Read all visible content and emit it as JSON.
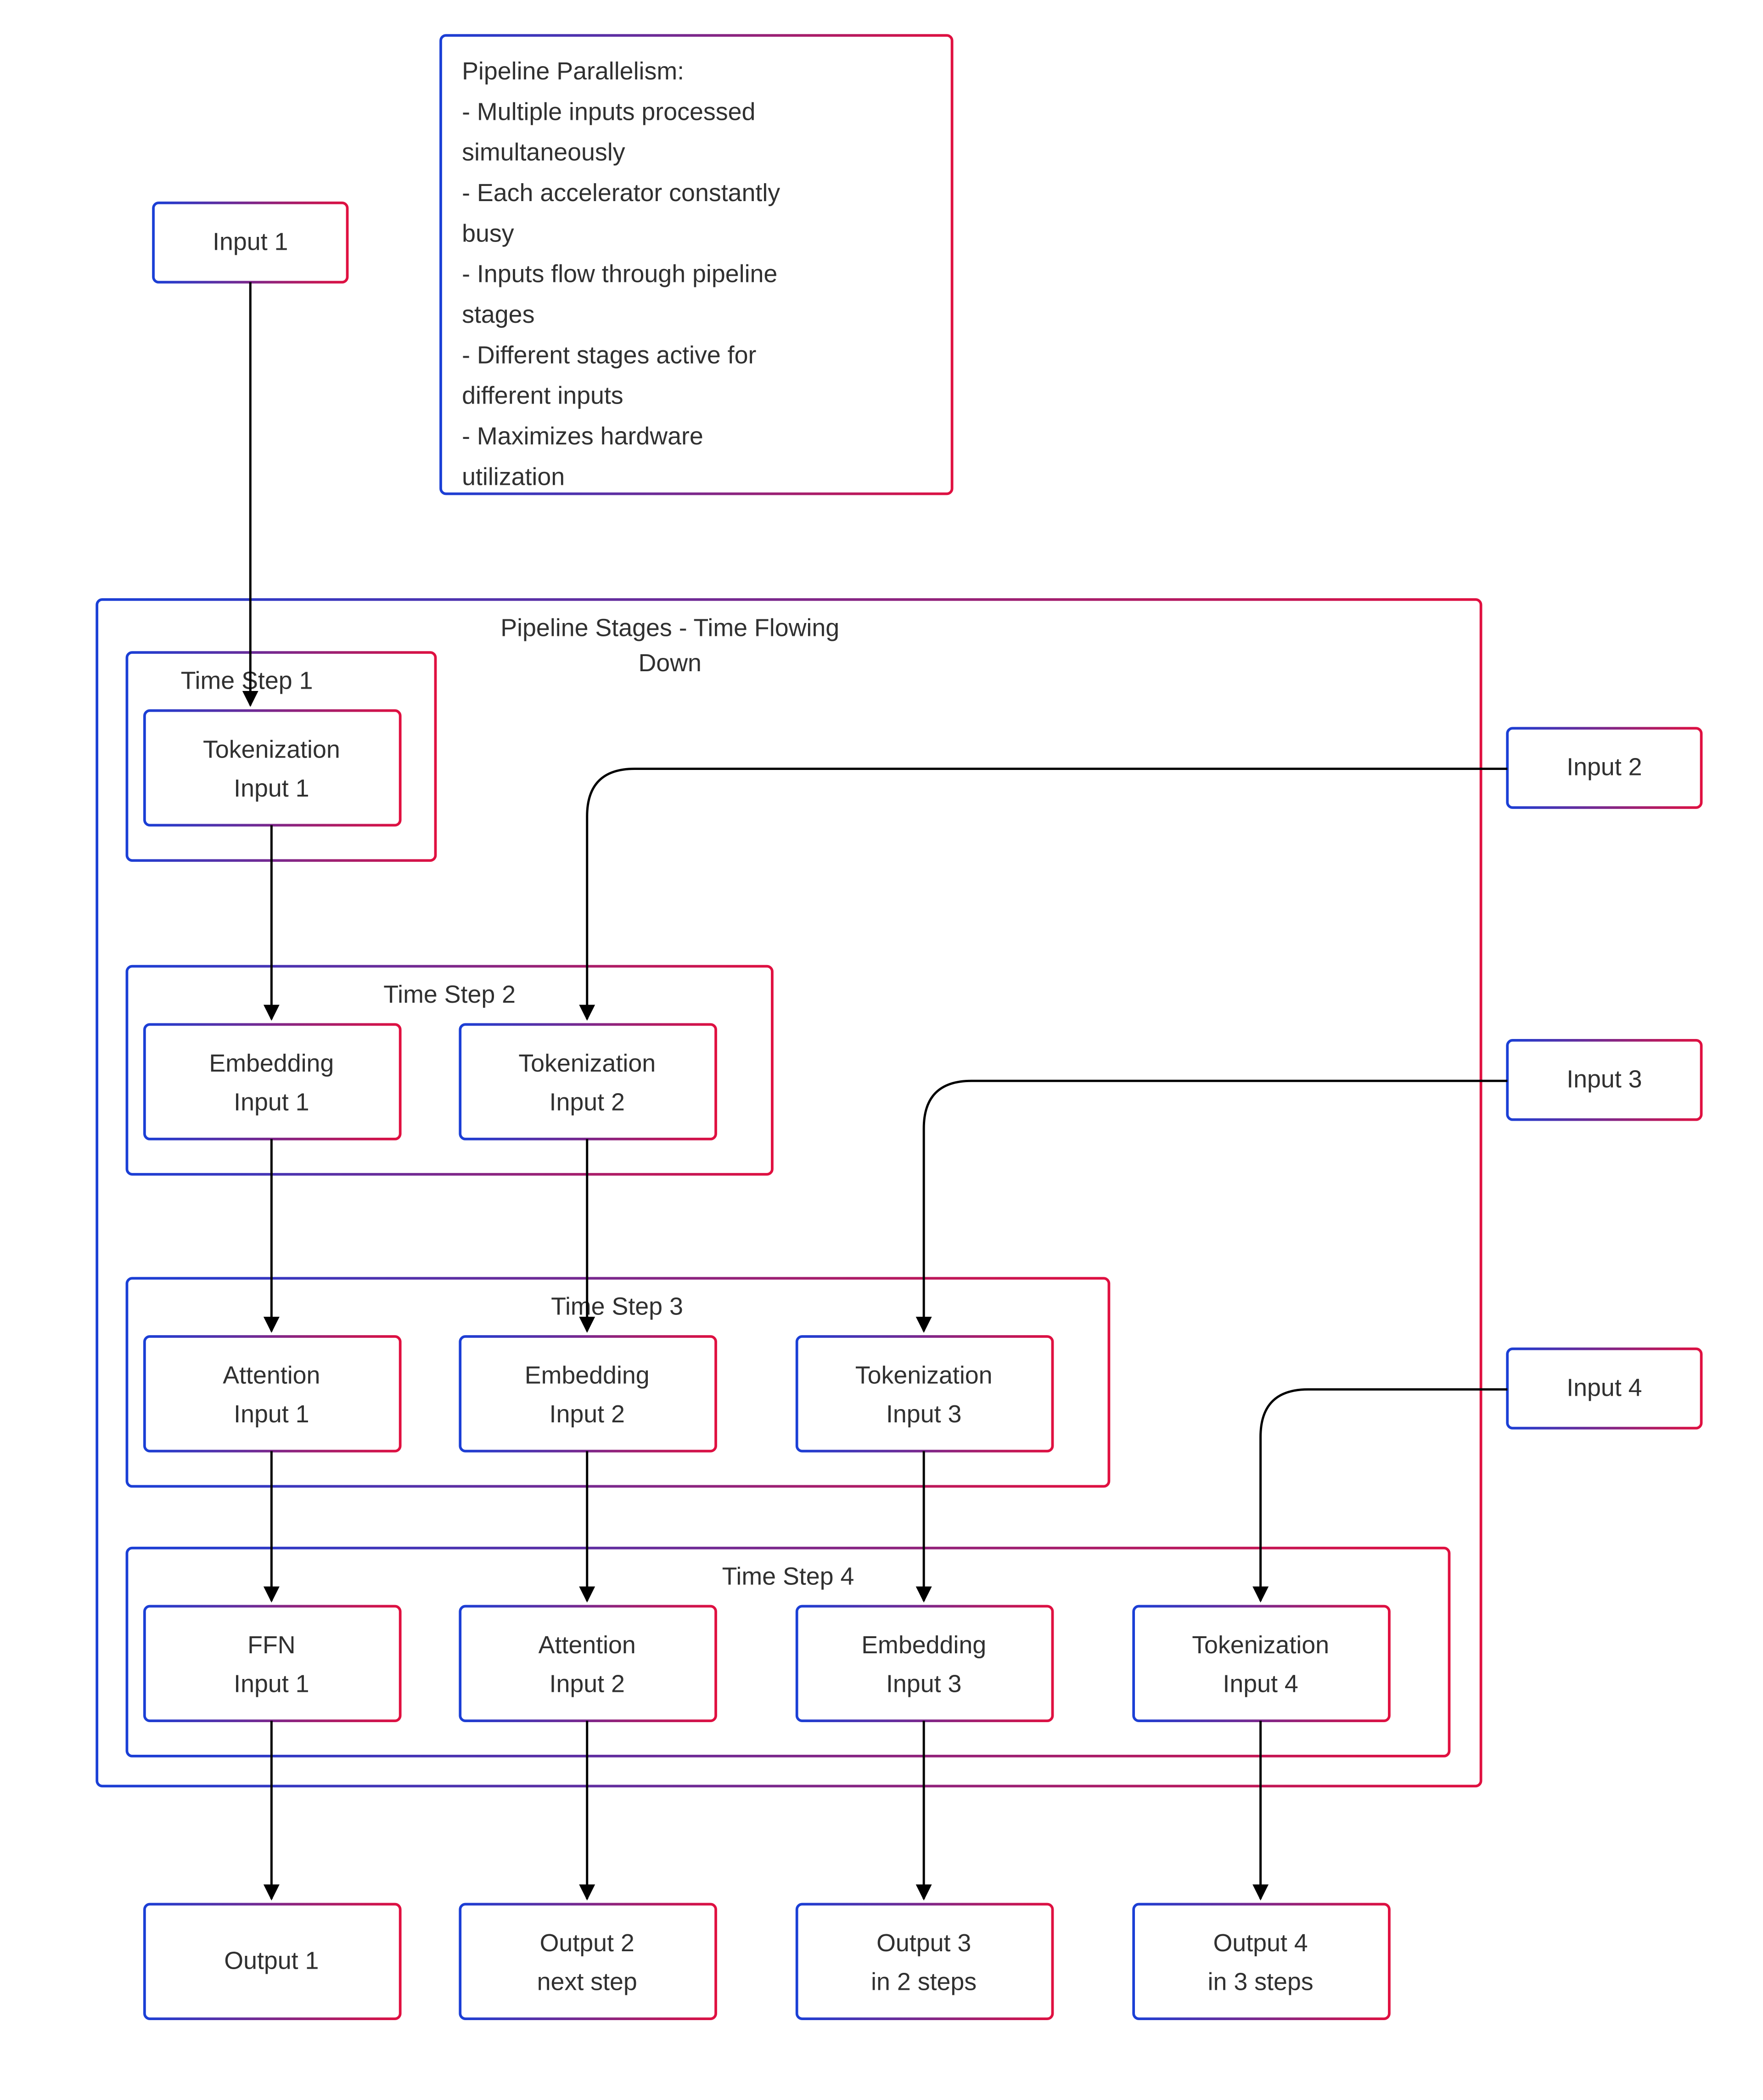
{
  "note": {
    "title": "Pipeline Parallelism:",
    "bullets": [
      "    - Multiple inputs processed",
      "simultaneously",
      "    - Each accelerator constantly",
      "busy",
      "    - Inputs flow through pipeline",
      "stages",
      "    - Different stages active for",
      "different inputs",
      "    - Maximizes hardware",
      "utilization"
    ]
  },
  "pipelineTitle1": "Pipeline Stages - Time Flowing",
  "pipelineTitle2": "Down",
  "inputs": {
    "i1": "Input 1",
    "i2": "Input 2",
    "i3": "Input 3",
    "i4": "Input 4"
  },
  "timesteps": {
    "t1": {
      "label": "Time Step 1",
      "cells": [
        "Tokenization",
        "Input 1"
      ]
    },
    "t2": {
      "label": "Time Step 2",
      "c1": [
        "Embedding",
        "Input 1"
      ],
      "c2": [
        "Tokenization",
        "Input 2"
      ]
    },
    "t3": {
      "label": "Time Step 3",
      "c1": [
        "Attention",
        "Input 1"
      ],
      "c2": [
        "Embedding",
        "Input 2"
      ],
      "c3": [
        "Tokenization",
        "Input 3"
      ]
    },
    "t4": {
      "label": "Time Step 4",
      "c1": [
        "FFN",
        "Input 1"
      ],
      "c2": [
        "Attention",
        "Input 2"
      ],
      "c3": [
        "Embedding",
        "Input 3"
      ],
      "c4": [
        "Tokenization",
        "Input 4"
      ]
    }
  },
  "outputs": {
    "o1": [
      "Output 1"
    ],
    "o2": [
      "Output 2",
      "next step"
    ],
    "o3": [
      "Output 3",
      "in 2 steps"
    ],
    "o4": [
      "Output 4",
      "in 3 steps"
    ]
  }
}
